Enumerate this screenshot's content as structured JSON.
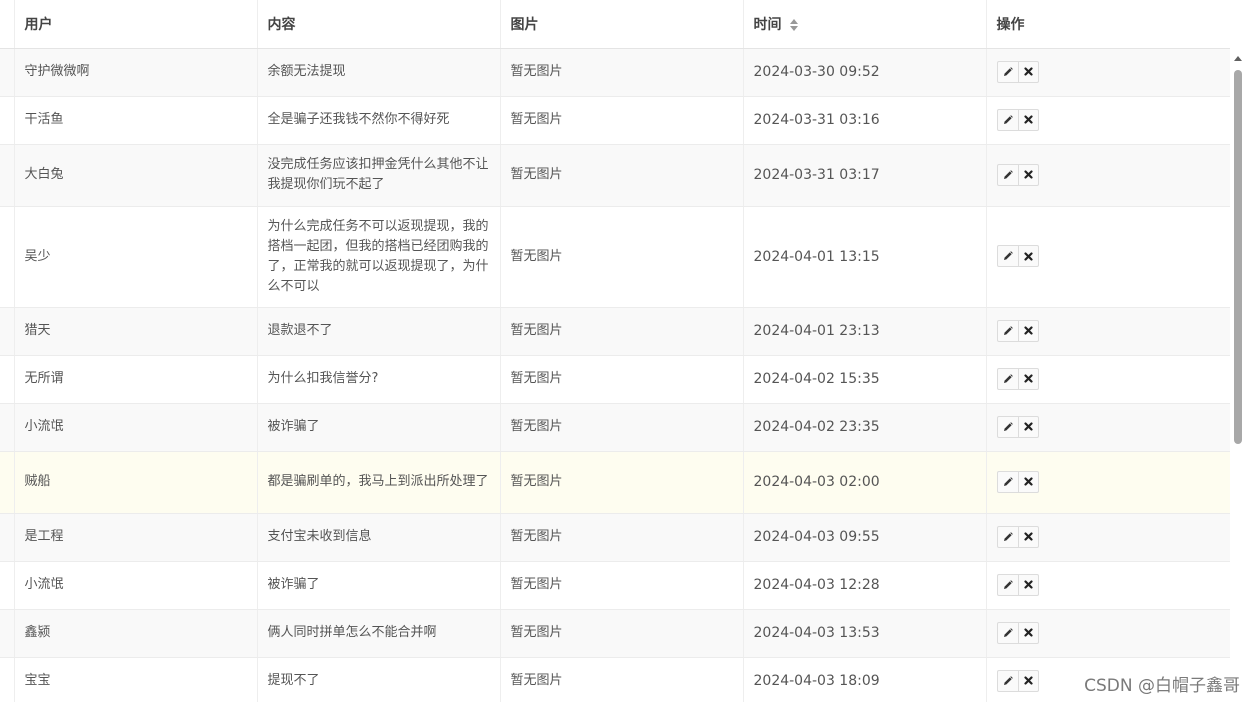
{
  "table": {
    "headers": {
      "user": "用户",
      "content": "内容",
      "image": "图片",
      "time": "时间",
      "actions": "操作"
    },
    "rows": [
      {
        "user": "守护微微啊",
        "content": "余额无法提现",
        "image": "暂无图片",
        "time": "2024-03-30 09:52",
        "has_actions": true
      },
      {
        "user": "干活鱼",
        "content": "全是骗子还我钱不然你不得好死",
        "image": "暂无图片",
        "time": "2024-03-31 03:16",
        "has_actions": true
      },
      {
        "user": "大白兔",
        "content": "没完成任务应该扣押金凭什么其他不让我提现你们玩不起了",
        "image": "暂无图片",
        "time": "2024-03-31 03:17",
        "has_actions": true
      },
      {
        "user": "吴少",
        "content": "为什么完成任务不可以返现提现，我的搭档一起团，但我的搭档已经团购我的了，正常我的就可以返现提现了，为什么不可以",
        "image": "暂无图片",
        "time": "2024-04-01 13:15",
        "has_actions": true
      },
      {
        "user": "猎天",
        "content": "退款退不了",
        "image": "暂无图片",
        "time": "2024-04-01 23:13",
        "has_actions": true
      },
      {
        "user": "无所谓",
        "content": "为什么扣我信誉分?",
        "image": "暂无图片",
        "time": "2024-04-02 15:35",
        "has_actions": true
      },
      {
        "user": "小流氓",
        "content": "被诈骗了",
        "image": "暂无图片",
        "time": "2024-04-02 23:35",
        "has_actions": true
      },
      {
        "user": "贼船",
        "content": "都是骗刷单的，我马上到派出所处理了",
        "image": "暂无图片",
        "time": "2024-04-03 02:00",
        "has_actions": true
      },
      {
        "user": "是工程",
        "content": "支付宝未收到信息",
        "image": "暂无图片",
        "time": "2024-04-03 09:55",
        "has_actions": true
      },
      {
        "user": "小流氓",
        "content": "被诈骗了",
        "image": "暂无图片",
        "time": "2024-04-03 12:28",
        "has_actions": true
      },
      {
        "user": "鑫颍",
        "content": "俩人同时拼单怎么不能合并啊",
        "image": "暂无图片",
        "time": "2024-04-03 13:53",
        "has_actions": true
      },
      {
        "user": "宝宝",
        "content": "提现不了",
        "image": "暂无图片",
        "time": "2024-04-03 18:09",
        "has_actions": true
      }
    ]
  },
  "icons": {
    "edit": "pencil-icon",
    "delete": "close-icon",
    "sort": "sort-icon"
  },
  "colors": {
    "row_alt": "#f9f9f9",
    "row_highlight": "#fefdf0",
    "border": "#ececec"
  },
  "watermark": "CSDN @白帽子鑫哥"
}
